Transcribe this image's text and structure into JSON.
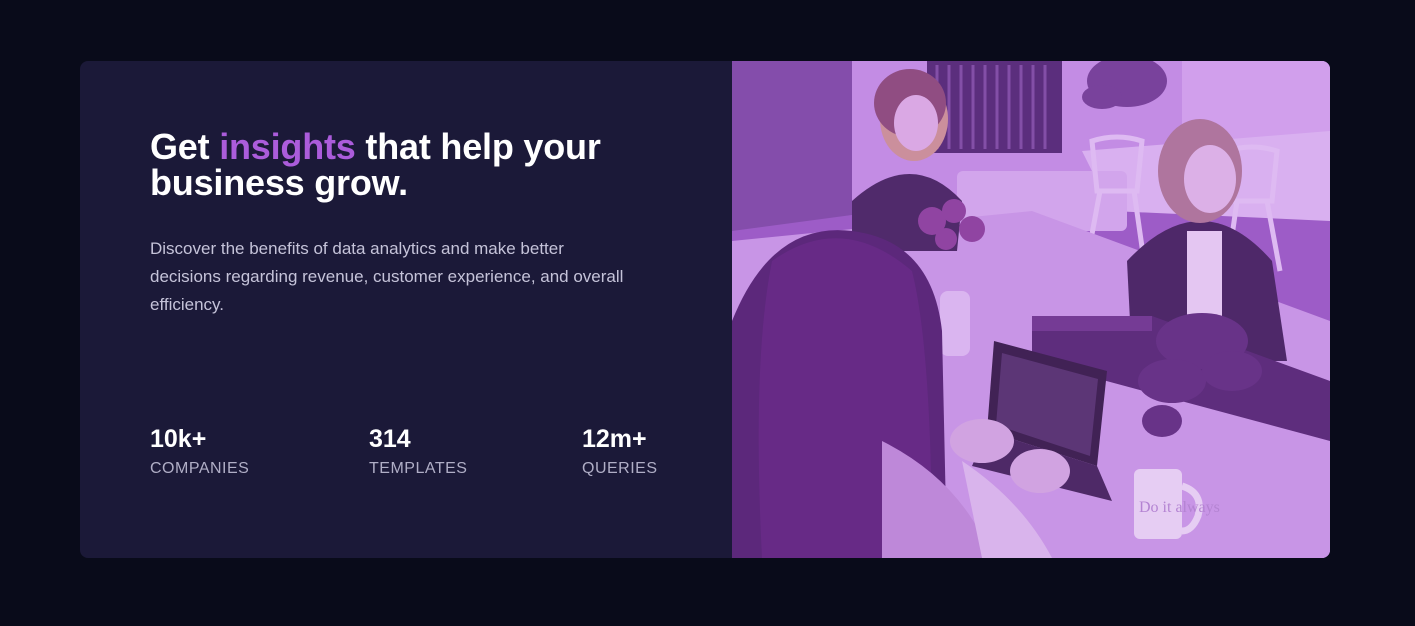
{
  "hero": {
    "headline_before": "Get ",
    "headline_accent": "insights",
    "headline_after": " that help your business grow.",
    "description": "Discover the benefits of data analytics and make better decisions regarding revenue, customer experience, and overall efficiency."
  },
  "stats": [
    {
      "value": "10k+",
      "label": "COMPANIES"
    },
    {
      "value": "314",
      "label": "TEMPLATES"
    },
    {
      "value": "12m+",
      "label": "QUERIES"
    }
  ],
  "photo": {
    "mug_text": "Do it always"
  },
  "colors": {
    "page_background": "#090b1a",
    "card_background": "#1b1938",
    "accent": "#ab5cdb",
    "photo_overlay": "#aa5cdb"
  }
}
